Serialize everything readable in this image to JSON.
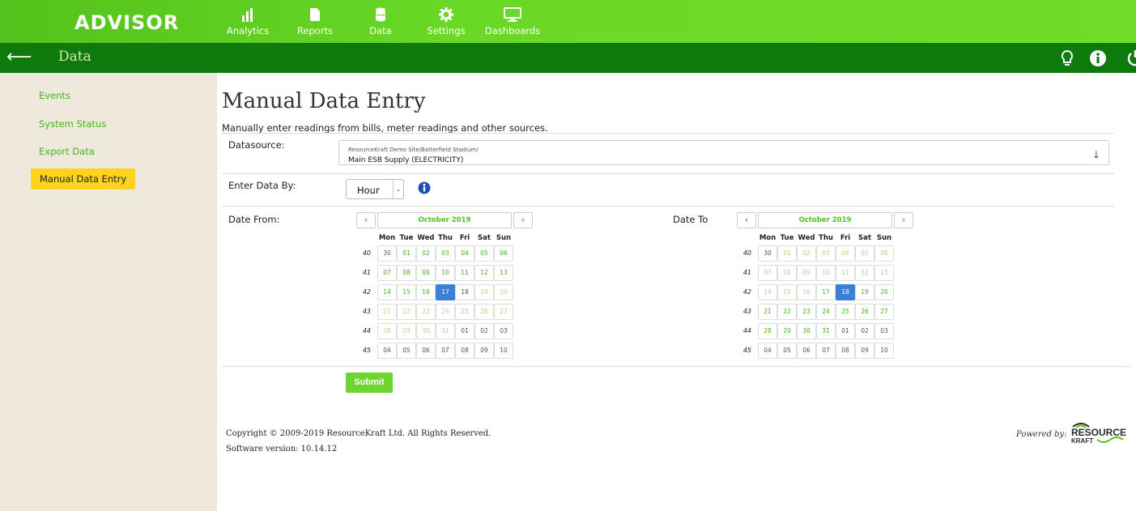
{
  "app": {
    "logo": "ADVISOR"
  },
  "nav": [
    {
      "label": "Analytics",
      "icon": "bar-chart-icon"
    },
    {
      "label": "Reports",
      "icon": "document-icon"
    },
    {
      "label": "Data",
      "icon": "database-icon"
    },
    {
      "label": "Settings",
      "icon": "gear-icon"
    },
    {
      "label": "Dashboards",
      "icon": "monitor-icon"
    }
  ],
  "subbar": {
    "title": "Data"
  },
  "sidebar": {
    "items": [
      {
        "label": "Events"
      },
      {
        "label": "System Status"
      },
      {
        "label": "Export Data"
      },
      {
        "label": "Manual Data Entry"
      }
    ]
  },
  "main": {
    "title": "Manual Data Entry",
    "subtitle": "Manually enter readings from bills, meter readings and other sources.",
    "datasource_label": "Datasource:",
    "datasource_path": "ResourceKraft Demo Site/Batterfield Stadium/",
    "datasource_value": "Main ESB Supply (ELECTRICITY)",
    "enter_by_label": "Enter Data By:",
    "enter_by_value": "Hour",
    "date_from_label": "Date From:",
    "date_to_label": "Date To",
    "submit_label": "Submit"
  },
  "cal_from": {
    "title": "October 2019",
    "dow": [
      "Mon",
      "Tue",
      "Wed",
      "Thu",
      "Fri",
      "Sat",
      "Sun"
    ],
    "weeks": [
      "40",
      "41",
      "42",
      "43",
      "44",
      "45"
    ],
    "days": [
      [
        "30",
        "01",
        "02",
        "03",
        "04",
        "05",
        "06"
      ],
      [
        "07",
        "08",
        "09",
        "10",
        "11",
        "12",
        "13"
      ],
      [
        "14",
        "15",
        "16",
        "17",
        "18",
        "19",
        "20"
      ],
      [
        "21",
        "22",
        "23",
        "24",
        "25",
        "26",
        "27"
      ],
      [
        "28",
        "29",
        "30",
        "31",
        "01",
        "02",
        "03"
      ],
      [
        "04",
        "05",
        "06",
        "07",
        "08",
        "09",
        "10"
      ]
    ]
  },
  "cal_to": {
    "title": "October 2019",
    "dow": [
      "Mon",
      "Tue",
      "Wed",
      "Thu",
      "Fri",
      "Sat",
      "Sun"
    ],
    "weeks": [
      "40",
      "41",
      "42",
      "43",
      "44",
      "45"
    ],
    "days": [
      [
        "30",
        "01",
        "02",
        "03",
        "04",
        "05",
        "06"
      ],
      [
        "07",
        "08",
        "09",
        "10",
        "11",
        "12",
        "13"
      ],
      [
        "14",
        "15",
        "16",
        "17",
        "18",
        "19",
        "20"
      ],
      [
        "21",
        "22",
        "23",
        "24",
        "25",
        "26",
        "27"
      ],
      [
        "28",
        "29",
        "30",
        "31",
        "01",
        "02",
        "03"
      ],
      [
        "04",
        "05",
        "06",
        "07",
        "08",
        "09",
        "10"
      ]
    ]
  },
  "footer": {
    "copyright": "Copyright © 2009-2019 ResourceKraft Ltd. All Rights Reserved.",
    "version": "Software version: 10.14.12",
    "powered_by": "Powered by:",
    "brand_line1": "RESOURCE",
    "brand_line2": "KRAFT"
  },
  "colors": {
    "brand_green": "#6ad826",
    "dark_green": "#0e7a0c",
    "accent_yellow": "#ffd21f",
    "selected_blue": "#3d7fd2"
  }
}
